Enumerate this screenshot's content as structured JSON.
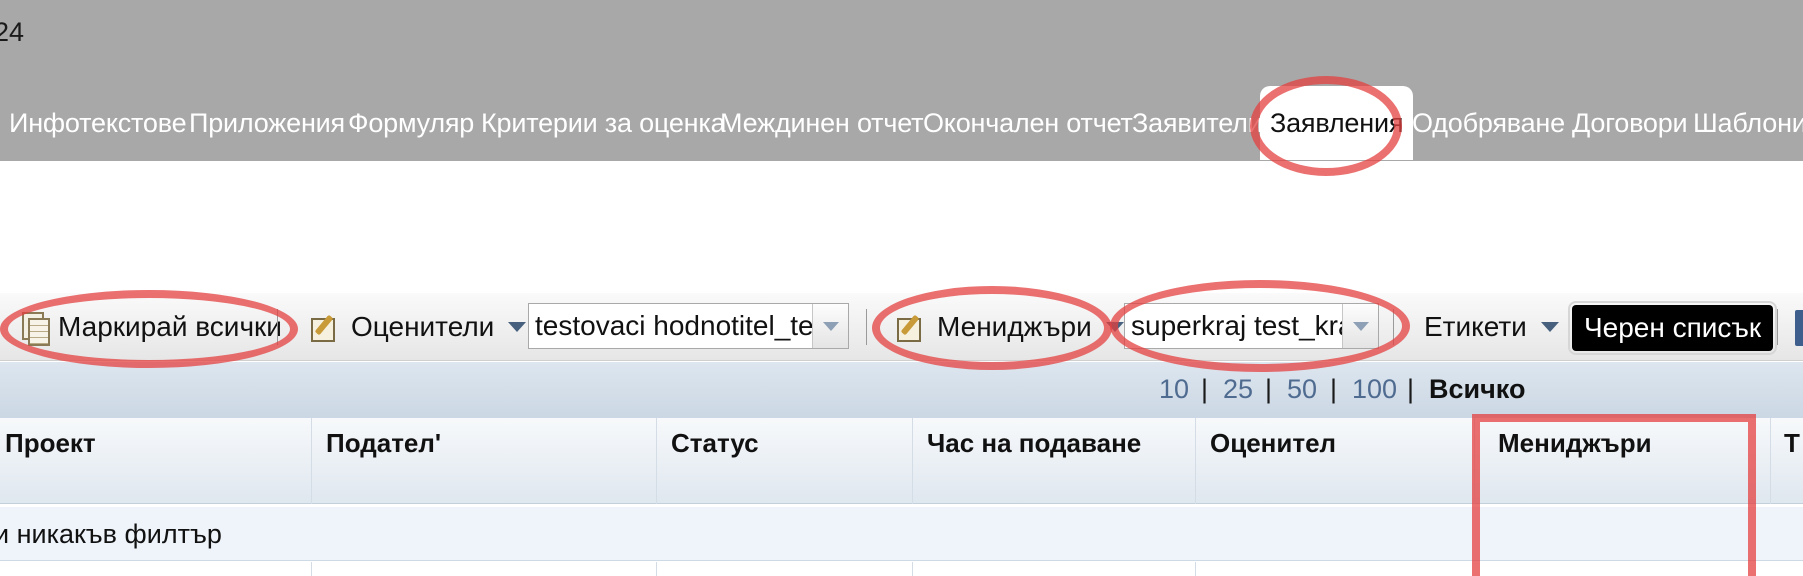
{
  "header": {
    "top_text": "24",
    "nav": [
      {
        "label": "Инфотекстове"
      },
      {
        "label": "Приложения"
      },
      {
        "label": "Формуляр"
      },
      {
        "label": "Критерии за оценка"
      },
      {
        "label": "Междинен отчет"
      },
      {
        "label": "Окончален отчет"
      },
      {
        "label": "Заявители"
      },
      {
        "label": "Заявления",
        "active": true
      },
      {
        "label": "Одобряване"
      },
      {
        "label": "Договори"
      },
      {
        "label": "Шаблони"
      }
    ]
  },
  "toolbar": {
    "mark_all": "Маркирай всички",
    "evaluators": "Оценители",
    "evaluators_value": "testovaci hodnotitel_test",
    "managers": "Мениджъри",
    "managers_value": "superkraj test_kraj",
    "labels": "Етикети",
    "blacklist": "Черен списък"
  },
  "pager": {
    "options": [
      "10",
      "25",
      "50",
      "100"
    ],
    "current": "Всичко"
  },
  "table": {
    "columns": [
      "Проект",
      "Подател'",
      "Статус",
      "Час на подаване",
      "Оценител",
      "Мениджъри",
      "Т"
    ],
    "filter_text": "и никакъв филтър"
  },
  "colors": {
    "header_bg": "#a8a8a8",
    "highlight": "#e44040",
    "blacklist_bg": "#000000",
    "pager_link": "#4f6b90"
  },
  "icons": [
    "document-icon",
    "pen-note-icon",
    "dropdown-caret-icon",
    "combo-arrow-icon"
  ]
}
